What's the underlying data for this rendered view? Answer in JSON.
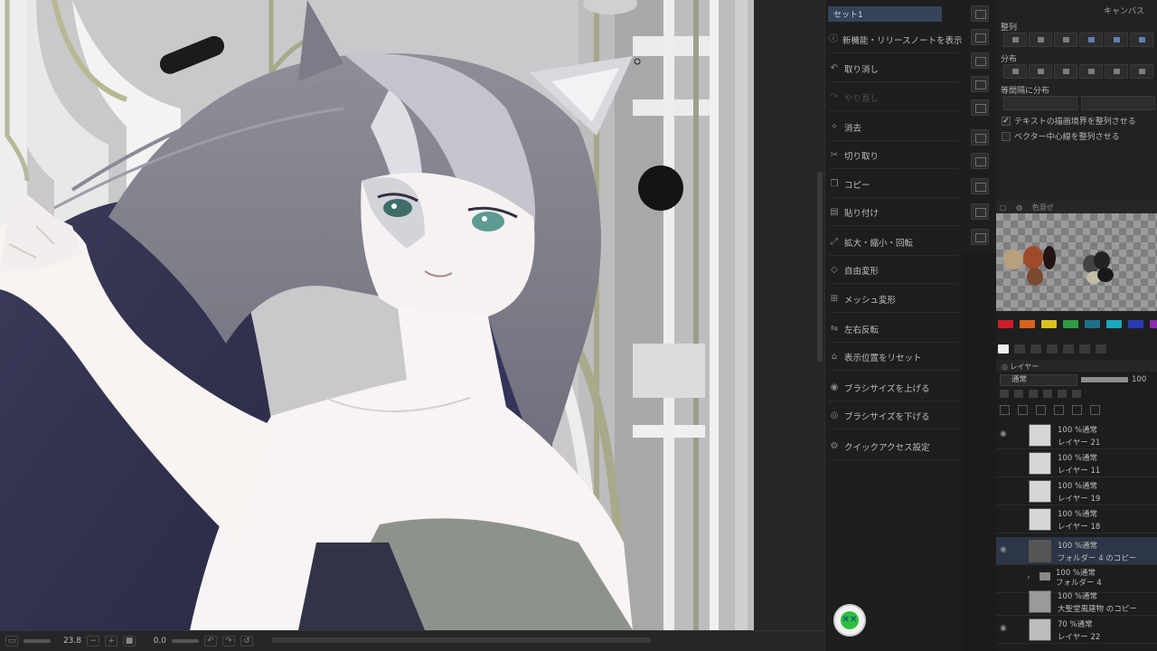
{
  "menu_panel": {
    "set_tab": "セット1",
    "items": [
      {
        "label": "新機能・リリースノートを表示",
        "icon": "info-icon",
        "enabled": true
      },
      {
        "label": "取り消し",
        "icon": "undo-icon",
        "enabled": true
      },
      {
        "label": "やり直し",
        "icon": "redo-icon",
        "enabled": false
      },
      {
        "label": "消去",
        "icon": "clear-icon",
        "enabled": true
      },
      {
        "label": "切り取り",
        "icon": "cut-icon",
        "enabled": true
      },
      {
        "label": "コピー",
        "icon": "copy-icon",
        "enabled": true
      },
      {
        "label": "貼り付け",
        "icon": "paste-icon",
        "enabled": true
      },
      {
        "label": "拡大・縮小・回転",
        "icon": "scale-rotate-icon",
        "enabled": true
      },
      {
        "label": "自由変形",
        "icon": "free-transform-icon",
        "enabled": true
      },
      {
        "label": "メッシュ変形",
        "icon": "mesh-transform-icon",
        "enabled": true
      },
      {
        "label": "左右反転",
        "icon": "flip-horizontal-icon",
        "enabled": true
      },
      {
        "label": "表示位置をリセット",
        "icon": "reset-view-icon",
        "enabled": true
      },
      {
        "label": "ブラシサイズを上げる",
        "icon": "brush-size-up-icon",
        "enabled": true
      },
      {
        "label": "ブラシサイズを下げる",
        "icon": "brush-size-down-icon",
        "enabled": true
      },
      {
        "label": "クイックアクセス設定",
        "icon": "quick-access-settings-icon",
        "enabled": true
      }
    ]
  },
  "align_panel": {
    "title": "キャンバス",
    "align_heading": "整列",
    "distribute_heading": "分布",
    "equal_spacing_heading": "等間隔に分布",
    "checkbox_text_bounds": {
      "label": "テキストの描画境界を整列させる",
      "checked": true
    },
    "checkbox_vector_center": {
      "label": "ベクター中心線を整列させる",
      "checked": false
    }
  },
  "palette_panel": {
    "tab_label": "色混ぜ",
    "swatch_colors": [
      "#cc1d2a",
      "#d9631c",
      "#d8c21f",
      "#2f9c43",
      "#1d6f8a",
      "#19a8c0",
      "#2a3bb5",
      "#8b2bb0"
    ]
  },
  "layer_panel": {
    "tab_label": "レイヤー",
    "blend_mode": "通常",
    "opacity": "100",
    "layers": [
      {
        "mode": "100 %通常",
        "name": "レイヤー 21",
        "visible": true,
        "type": "layer"
      },
      {
        "mode": "100 %通常",
        "name": "レイヤー 11",
        "visible": false,
        "type": "layer"
      },
      {
        "mode": "100 %通常",
        "name": "レイヤー 19",
        "visible": false,
        "type": "layer"
      },
      {
        "mode": "100 %通常",
        "name": "レイヤー 18",
        "visible": false,
        "type": "layer"
      },
      {
        "mode": "100 %通常",
        "name": "フォルダー 4 のコピー",
        "visible": true,
        "type": "layer",
        "selected": true
      },
      {
        "mode": "100 %通常",
        "name": "フォルダー 4",
        "visible": false,
        "type": "folder"
      },
      {
        "mode": "100 %通常",
        "name": "大聖堂風建物 のコピー",
        "visible": false,
        "type": "layer"
      },
      {
        "mode": "70 %通常",
        "name": "レイヤー 22",
        "visible": true,
        "type": "layer"
      }
    ]
  },
  "status_bar": {
    "zoom": "23.8",
    "rotation": "0.0"
  },
  "colors": {
    "accent": "#34435a",
    "panel_bg": "#1e1e1e",
    "text": "#bdbdbd"
  }
}
